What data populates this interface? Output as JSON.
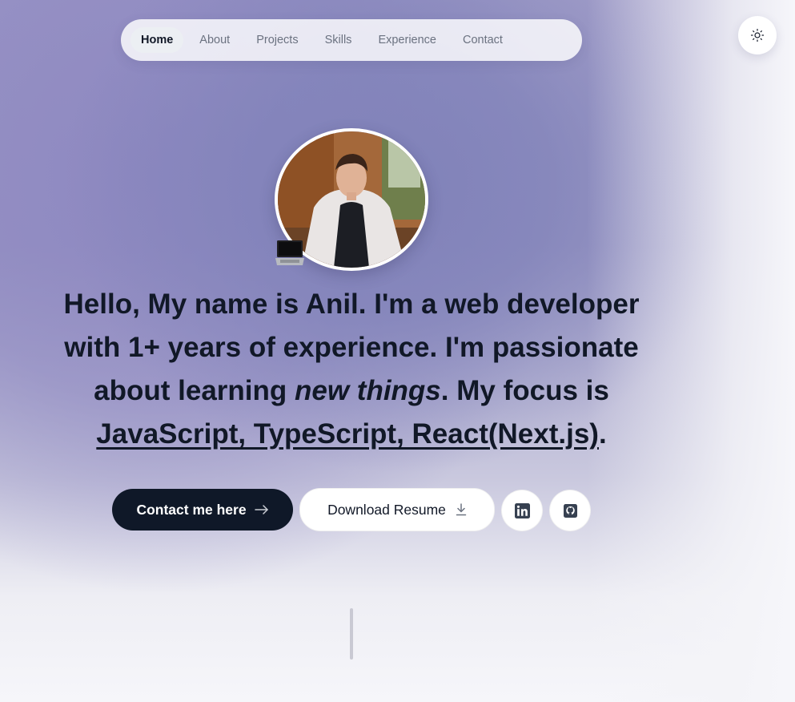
{
  "nav": {
    "items": [
      {
        "label": "Home",
        "active": true
      },
      {
        "label": "About"
      },
      {
        "label": "Projects"
      },
      {
        "label": "Skills"
      },
      {
        "label": "Experience"
      },
      {
        "label": "Contact"
      }
    ]
  },
  "theme_toggle": {
    "icon": "sun-icon"
  },
  "intro": {
    "p1": "Hello, My name is ",
    "name": "Anil.",
    "p2": " I'm a ",
    "role": "web developer",
    "p3": " with ",
    "years": "1+ years",
    "p4": " of experience. I'm passionate about learning ",
    "learning": "new things",
    "p5": ". My focus is ",
    "tech": "JavaScript, TypeScript, React(Next.js)",
    "p6": "."
  },
  "buttons": {
    "contact_label": "Contact me here",
    "contact_icon": "arrow-right-icon",
    "resume_label": "Download Resume",
    "resume_icon": "download-icon",
    "linkedin_icon": "linkedin-icon",
    "github_icon": "github-icon"
  },
  "colors": {
    "primary": "#0f1828",
    "accent_bg": "#8f8bc2"
  }
}
